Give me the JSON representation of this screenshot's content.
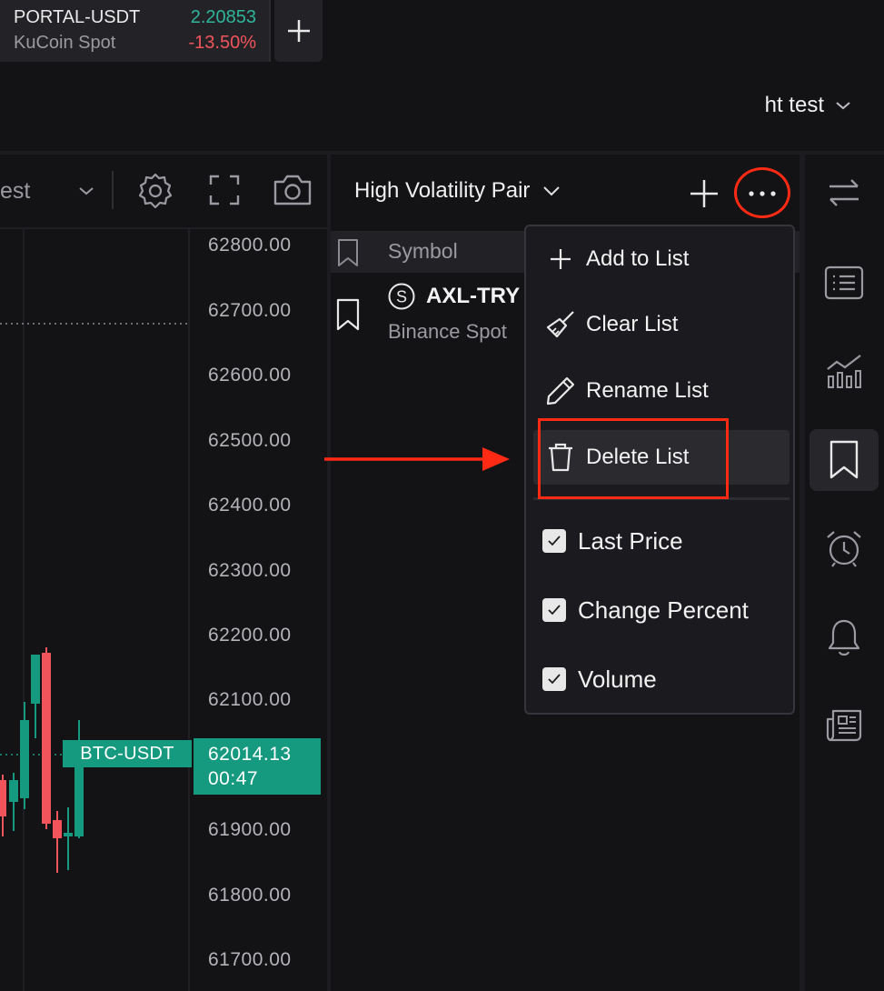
{
  "ticker_tab": {
    "symbol": "PORTAL-USDT",
    "exchange": "KuCoin Spot",
    "price": "2.20853",
    "change": "-13.50%"
  },
  "header": {
    "user_name": "ht test"
  },
  "chart_toolbar": {
    "dropdown_text": "est"
  },
  "chart": {
    "price_labels": [
      "62800.00",
      "62700.00",
      "62600.00",
      "62500.00",
      "62400.00",
      "62300.00",
      "62200.00",
      "62100.00",
      "61900.00",
      "61800.00",
      "61700.00"
    ],
    "symbol_tag": "BTC-USDT",
    "last_price": "62014.13",
    "countdown": "00:47"
  },
  "watchlist": {
    "title": "High Volatility Pair",
    "column_symbol": "Symbol",
    "row_symbol": "AXL-TRY",
    "row_exchange": "Binance Spot"
  },
  "menu": {
    "add_to_list": "Add to List",
    "clear_list": "Clear List",
    "rename_list": "Rename List",
    "delete_list": "Delete List",
    "last_price": "Last Price",
    "change_percent": "Change Percent",
    "volume": "Volume"
  },
  "colors": {
    "up": "#15997f",
    "down": "#f2545b",
    "annotation": "#ff2a14"
  }
}
